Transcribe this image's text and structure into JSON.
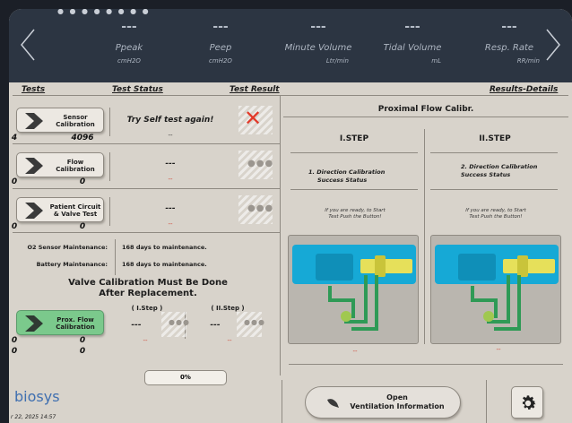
{
  "header": {
    "metrics": [
      {
        "value": "---",
        "name": "Ppeak",
        "unit": "cmH2O"
      },
      {
        "value": "---",
        "name": "Peep",
        "unit": "cmH2O"
      },
      {
        "value": "---",
        "name": "Minute Volume",
        "unit": "Ltr/min"
      },
      {
        "value": "---",
        "name": "Tidal Volume",
        "unit": "mL"
      },
      {
        "value": "---",
        "name": "Resp. Rate",
        "unit": "RR/min"
      }
    ]
  },
  "columns": {
    "tests": "Tests",
    "status": "Test Status",
    "result": "Test Result",
    "details": "Results-Details"
  },
  "tests": [
    {
      "label": "Sensor Calibration",
      "num1": "4",
      "num2": "4096",
      "status": "Try Self test again!",
      "sub": "--"
    },
    {
      "label": "Flow Calibration",
      "num1": "0",
      "num2": "0",
      "status": "---",
      "sub": "--"
    },
    {
      "label": "Patient Circuit & Valve Test",
      "num1": "0",
      "num2": "0",
      "status": "---",
      "sub": "--"
    }
  ],
  "maintenance": [
    {
      "label": "O2 Sensor Maintenance:",
      "value": "168 days to maintenance."
    },
    {
      "label": "Battery Maintenance:",
      "value": "168 days to maintenance."
    }
  ],
  "valve_notice": "Valve Calibration Must Be Done After Replacement.",
  "prox": {
    "label": "Prox. Flow Calibration",
    "step1_label": "( I.Step )",
    "step2_label": "( II.Step )",
    "step1_value": "---",
    "step2_value": "---",
    "sub1": "--",
    "sub2": "--",
    "row1": [
      "0",
      "0"
    ],
    "row2": [
      "0",
      "0"
    ]
  },
  "progress": "0%",
  "progress_fraction": 0,
  "details": {
    "title": "Proximal Flow Calibr.",
    "steps": [
      {
        "name": "I.STEP",
        "instruction": "1. Direction Calibration",
        "status": "Success Status",
        "note": "If you are ready, to Start Test Push the Button!",
        "sub": "--"
      },
      {
        "name": "II.STEP",
        "instruction": "2. Direction Calibration",
        "status": "Success Status",
        "note": "If you are ready, to Start Test Push the Button!",
        "sub": "--"
      }
    ]
  },
  "open_button": {
    "line1": "Open",
    "line2": "Ventilation Information"
  },
  "brand": "biosys",
  "datetime": "r 22, 2025  14:57",
  "colors": {
    "header": "#2c3542",
    "panel": "#d8d3cb",
    "accent_green": "#7bc98c",
    "error_red": "#e23a2a",
    "device_blue": "#16a9d6"
  },
  "icons": {
    "left": "chevron-left-icon",
    "right": "chevron-right-icon",
    "result_fail": "x-icon",
    "settings": "gear-icon"
  }
}
